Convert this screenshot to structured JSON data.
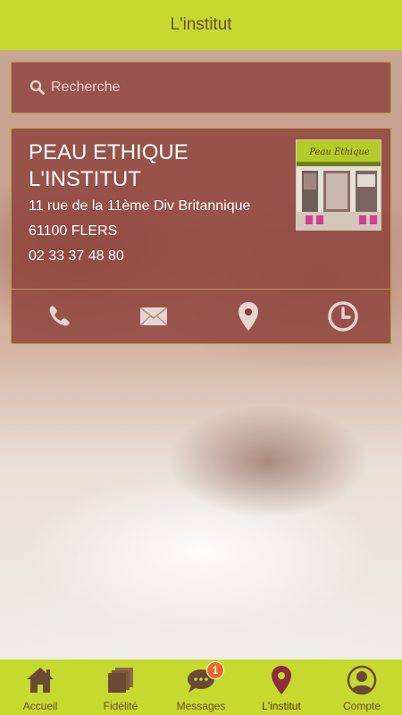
{
  "header": {
    "title": "L'institut"
  },
  "search": {
    "placeholder": "Recherche"
  },
  "institute": {
    "name_line1": "PEAU ETHIQUE",
    "name_line2": "L'INSTITUT",
    "address": "11 rue de la 11ème Div Britannique",
    "city": "61100 FLERS",
    "phone": "02 33 37 48 80",
    "logo_text": "Peau Ethique"
  },
  "actions": [
    {
      "icon": "phone-icon"
    },
    {
      "icon": "mail-icon"
    },
    {
      "icon": "location-pin-icon"
    },
    {
      "icon": "clock-icon"
    }
  ],
  "tabbar": {
    "items": [
      {
        "label": "Accueil",
        "icon": "home-icon"
      },
      {
        "label": "Fidélité",
        "icon": "cards-icon"
      },
      {
        "label": "Messages",
        "icon": "chat-bubble-icon",
        "badge": "1"
      },
      {
        "label": "L'institut",
        "icon": "location-pin-icon",
        "active": true
      },
      {
        "label": "Compte",
        "icon": "user-icon"
      }
    ]
  },
  "colors": {
    "accent": "#c6d92e",
    "card": "#8b3e38",
    "text_brown": "#6b4a35",
    "badge": "#f26522"
  }
}
